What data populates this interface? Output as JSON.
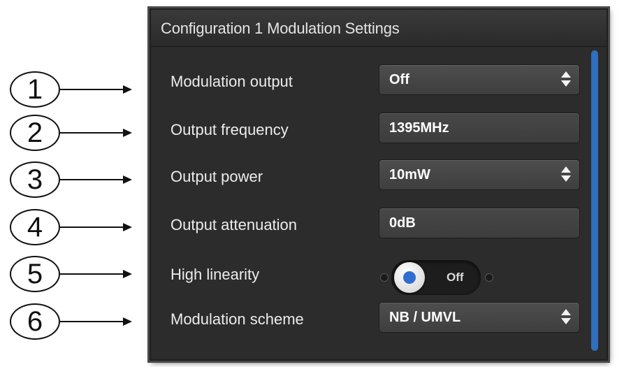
{
  "callouts": [
    "1",
    "2",
    "3",
    "4",
    "5",
    "6"
  ],
  "panel": {
    "title": "Configuration 1 Modulation Settings",
    "accent_color": "#2f6fbd"
  },
  "rows": [
    {
      "label": "Modulation output",
      "value": "Off",
      "control": "select"
    },
    {
      "label": "Output frequency",
      "value": "1395MHz",
      "control": "text"
    },
    {
      "label": "Output power",
      "value": "10mW",
      "control": "select"
    },
    {
      "label": "Output attenuation",
      "value": "0dB",
      "control": "text"
    },
    {
      "label": "High linearity",
      "value": "Off",
      "control": "toggle"
    },
    {
      "label": "Modulation scheme",
      "value": "NB / UMVL",
      "control": "select"
    }
  ],
  "icons": {
    "select": "updown-chevron-icon",
    "toggle_knob": "toggle-knob-icon"
  }
}
